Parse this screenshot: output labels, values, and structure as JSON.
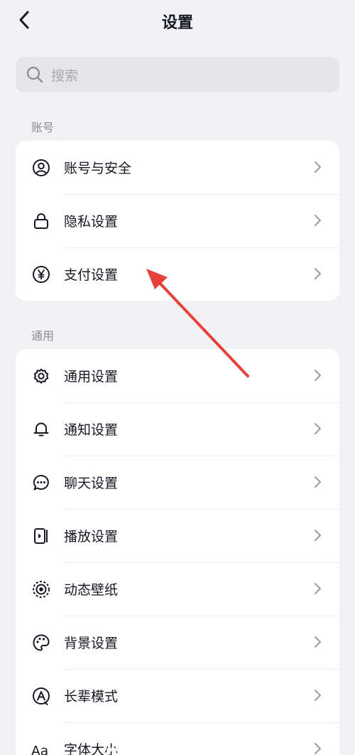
{
  "header": {
    "title": "设置",
    "back_icon": "chevron-left-icon"
  },
  "search": {
    "placeholder": "搜索",
    "icon": "search-icon"
  },
  "sections": [
    {
      "label": "账号",
      "items": [
        {
          "label": "账号与安全",
          "icon": "user-circle-icon"
        },
        {
          "label": "隐私设置",
          "icon": "lock-icon"
        },
        {
          "label": "支付设置",
          "icon": "yen-circle-icon"
        }
      ]
    },
    {
      "label": "通用",
      "items": [
        {
          "label": "通用设置",
          "icon": "gear-icon"
        },
        {
          "label": "通知设置",
          "icon": "bell-icon"
        },
        {
          "label": "聊天设置",
          "icon": "chat-bubble-icon"
        },
        {
          "label": "播放设置",
          "icon": "play-screen-icon"
        },
        {
          "label": "动态壁纸",
          "icon": "live-wallpaper-icon"
        },
        {
          "label": "背景设置",
          "icon": "palette-icon"
        },
        {
          "label": "长辈模式",
          "icon": "elder-mode-icon"
        },
        {
          "label": "字体大小",
          "icon": "font-size-icon"
        }
      ]
    }
  ],
  "annotation": {
    "type": "red-arrow",
    "color": "#e8413a",
    "points_to": "支付设置"
  },
  "colors": {
    "background": "#f2f2f4",
    "card": "#ffffff",
    "text": "#161823",
    "muted": "#8a8b91"
  }
}
